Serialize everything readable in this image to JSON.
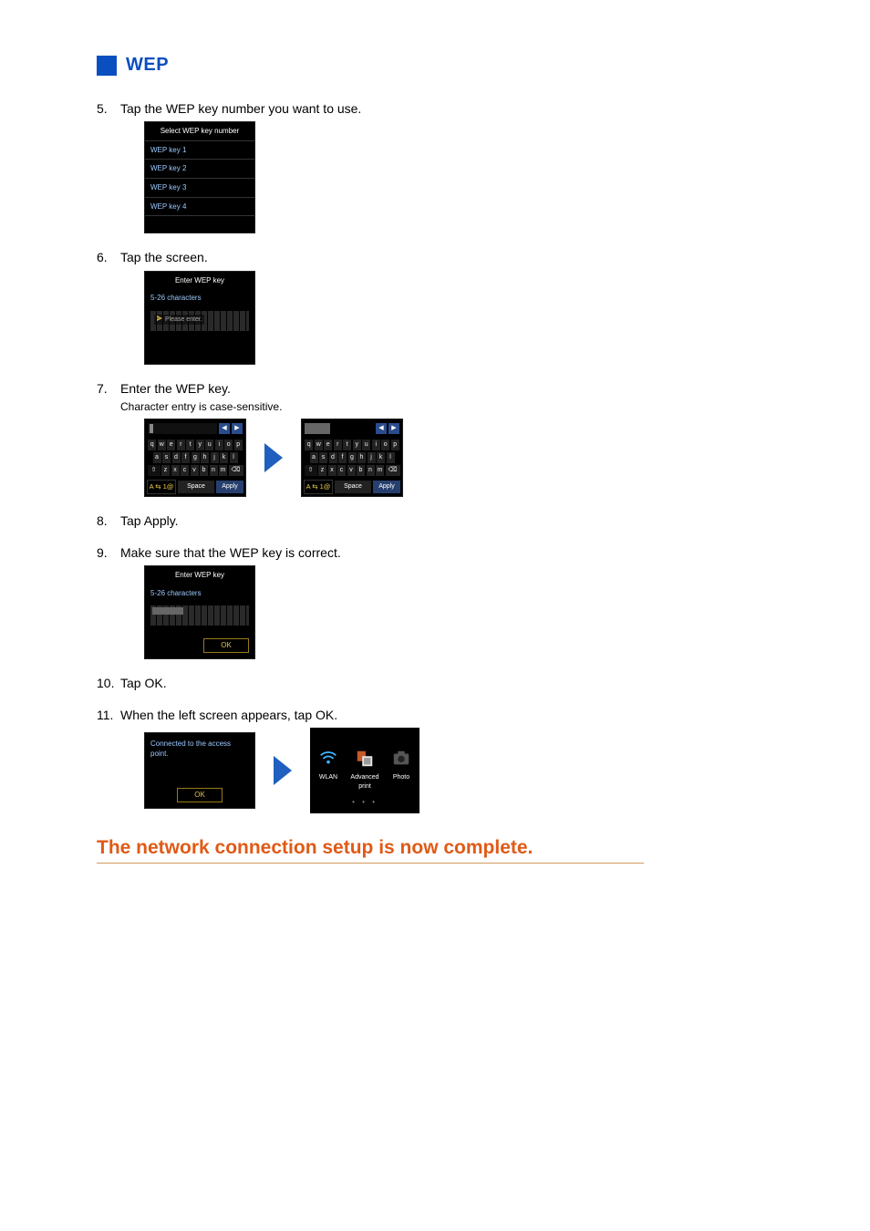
{
  "heading": "WEP",
  "steps": {
    "s5": "Tap the WEP key number you want to use.",
    "s6": "Tap the screen.",
    "s7": "Enter the WEP key.",
    "s7_sub": "Character entry is case-sensitive.",
    "s8": "Tap Apply.",
    "s9": "Make sure that the WEP key is correct.",
    "s10": "Tap OK.",
    "s11": "When the left screen appears, tap OK."
  },
  "screens": {
    "select_title": "Select WEP key number",
    "wep_keys": [
      "WEP key 1",
      "WEP key 2",
      "WEP key 3",
      "WEP key 4"
    ],
    "enter_title": "Enter WEP key",
    "char_hint": "5-26 characters",
    "placeholder": "Please enter.",
    "ok_label": "OK",
    "connected_msg": "Connected to the access point."
  },
  "keyboard": {
    "mode_label": "A ⇆ 1@",
    "space_label": "Space",
    "apply_label": "Apply",
    "row1": [
      "q",
      "w",
      "e",
      "r",
      "t",
      "y",
      "u",
      "i",
      "o",
      "p"
    ],
    "row2": [
      "a",
      "s",
      "d",
      "f",
      "g",
      "h",
      "j",
      "k",
      "l"
    ],
    "row3_mid": [
      "z",
      "x",
      "c",
      "v",
      "b",
      "n",
      "m"
    ],
    "arrow_left": "◀",
    "arrow_right": "▶",
    "shift": "⇧",
    "bksp": "⌫"
  },
  "home": {
    "wlan": "WLAN",
    "adv": "Advanced print",
    "photo": "Photo",
    "dots": "• • •"
  },
  "completion": "The network connection setup is now complete."
}
